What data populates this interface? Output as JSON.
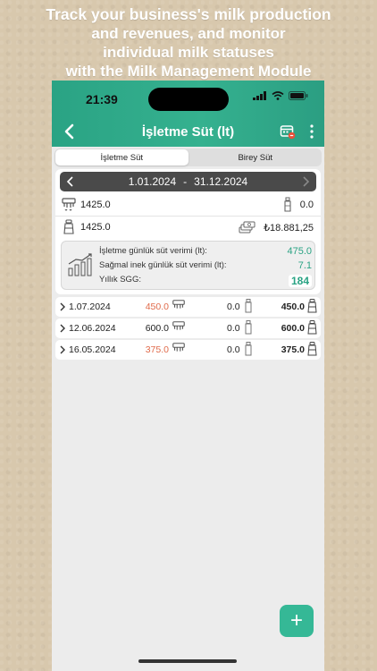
{
  "promo": {
    "line1": "Track your business's milk production",
    "line2": "and revenues, and monitor",
    "line3": "individual milk statuses",
    "line4_prefix": "with the ",
    "line4_bold": "Milk Management Module"
  },
  "status_bar": {
    "time": "21:39"
  },
  "nav": {
    "title": "İşletme Süt (lt)"
  },
  "tabs": [
    {
      "label": "İşletme Süt",
      "active": true
    },
    {
      "label": "Birey Süt",
      "active": false
    }
  ],
  "date_range": {
    "start": "1.01.2024",
    "separator": "-",
    "end": "31.12.2024"
  },
  "summary": {
    "milking_total": "1425.0",
    "bottle_total": "0.0",
    "can_total": "1425.0",
    "revenue": "₺18.881,25"
  },
  "stats": {
    "daily_yield_label": "İşletme günlük süt verimi (lt):",
    "daily_yield_value": "475.0",
    "cow_yield_label": "Sağmal inek günlük süt verimi (lt):",
    "cow_yield_value": "7.1",
    "sgg_label": "Yıllık SGG:",
    "sgg_value": "184"
  },
  "entries": [
    {
      "date": "1.07.2024",
      "milked": "450.0",
      "milked_highlight": true,
      "bottle": "0.0",
      "total": "450.0"
    },
    {
      "date": "12.06.2024",
      "milked": "600.0",
      "milked_highlight": false,
      "bottle": "0.0",
      "total": "600.0"
    },
    {
      "date": "16.05.2024",
      "milked": "375.0",
      "milked_highlight": true,
      "bottle": "0.0",
      "total": "375.0"
    }
  ],
  "fab": {
    "label": "+"
  },
  "colors": {
    "accent": "#35b18f",
    "highlight": "#e06a4a",
    "dark_bar": "#4a4a4a"
  }
}
